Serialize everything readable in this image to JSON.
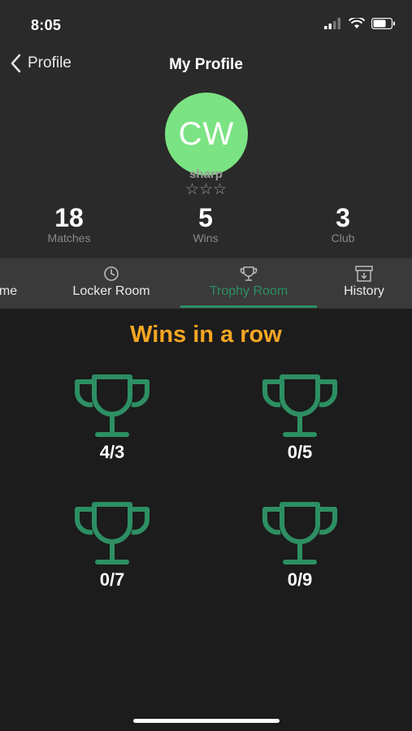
{
  "status_bar": {
    "time": "8:05"
  },
  "navbar": {
    "back_label": "Profile",
    "title": "My Profile"
  },
  "profile": {
    "initials": "CW",
    "avatar_color": "#7be383",
    "username": "sharp",
    "stars": "☆☆☆",
    "rating_filled": 0,
    "rating_max": 3
  },
  "stats": [
    {
      "value": "18",
      "label": "Matches"
    },
    {
      "value": "5",
      "label": "Wins"
    },
    {
      "value": "3",
      "label": "Club"
    }
  ],
  "tabs": [
    {
      "label": "me",
      "icon": "home-icon",
      "active": false
    },
    {
      "label": "Locker Room",
      "icon": "clock-icon",
      "active": false
    },
    {
      "label": "Trophy Room",
      "icon": "trophy-icon",
      "active": true
    },
    {
      "label": "History",
      "icon": "archive-icon",
      "active": false
    }
  ],
  "section": {
    "title": "Wins in a row"
  },
  "trophies": [
    {
      "progress": "4/3",
      "icon": "trophy-icon"
    },
    {
      "progress": "0/5",
      "icon": "trophy-icon"
    },
    {
      "progress": "0/7",
      "icon": "trophy-icon"
    },
    {
      "progress": "0/9",
      "icon": "trophy-icon"
    }
  ],
  "colors": {
    "accent": "#2d8f63",
    "title_orange": "#f5a623",
    "background": "#1c1c1c",
    "header_bg": "#2a2a2a",
    "tabbar_bg": "#3a3a3a"
  }
}
